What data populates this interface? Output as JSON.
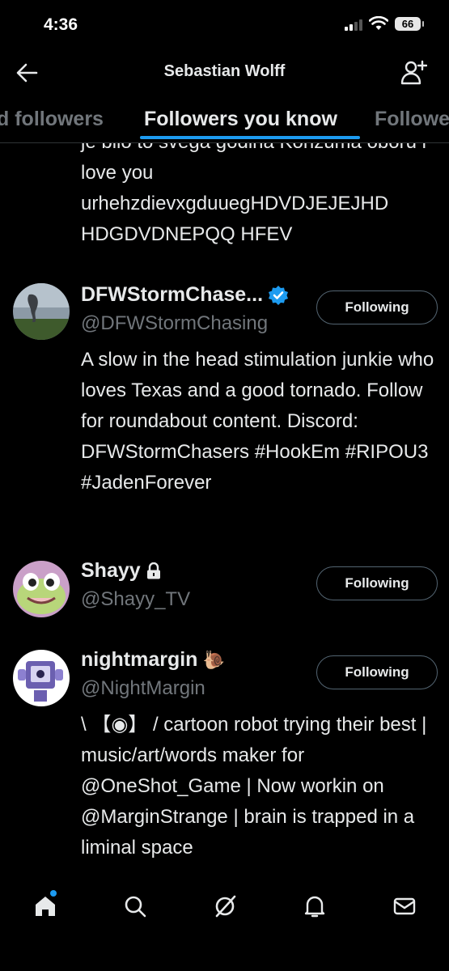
{
  "status": {
    "time": "4:36",
    "battery": "66"
  },
  "header": {
    "title": "Sebastian Wolff"
  },
  "tabs": [
    {
      "label": "d followers"
    },
    {
      "label": "Followers you know"
    },
    {
      "label": "Followe"
    }
  ],
  "previous_bio": "je bilo to svega godina Konzuma oboru i love you urhehzdievxgduuegHDVDJEJEJHD HDGDVDNEPQQ HFEV",
  "users": [
    {
      "name": "DFWStormChase...",
      "handle": "@DFWStormChasing",
      "verified": true,
      "button": "Following",
      "bio": "A slow in the head stimulation junkie who loves Texas and a good tornado. Follow for roundabout content. Discord: DFWStormChasers #HookEm #RIPOU3 #JadenForever"
    },
    {
      "name": "Shayy",
      "handle": "@Shayy_TV",
      "locked": true,
      "button": "Following",
      "bio": ""
    },
    {
      "name": "nightmargin",
      "name_emoji": "🐌",
      "handle": "@NightMargin",
      "button": "Following",
      "bio": "\\ 【◉】 / cartoon robot trying their best | music/art/words maker for @OneShot_Game | Now workin on @MarginStrange | brain is trapped in a liminal space"
    }
  ],
  "nav": [
    "home-icon",
    "search-icon",
    "grok-icon",
    "notifications-icon",
    "messages-icon"
  ],
  "colors": {
    "accent": "#1d9bf0",
    "background": "#000000",
    "text": "#e7e9ea",
    "muted": "#71767b"
  }
}
